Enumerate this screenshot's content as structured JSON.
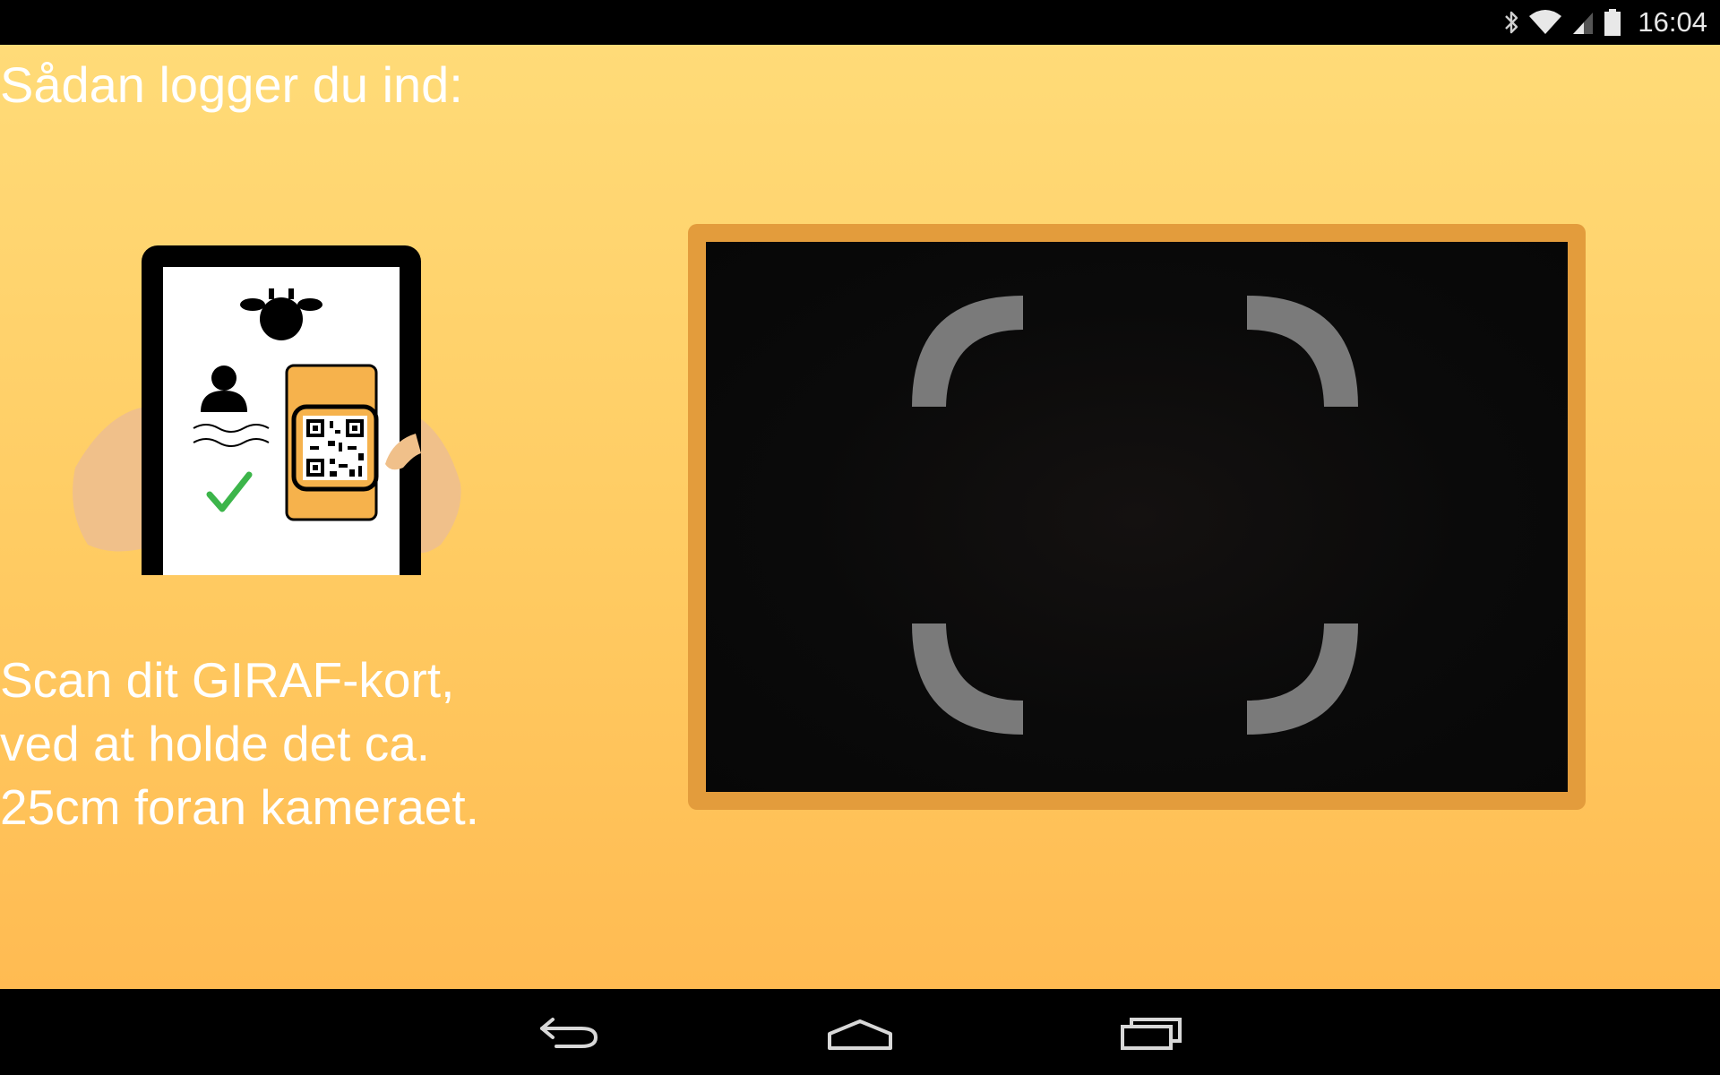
{
  "status_bar": {
    "time": "16:04",
    "icons": [
      "bluetooth-icon",
      "wifi-icon",
      "cell-signal-icon",
      "battery-icon"
    ]
  },
  "login": {
    "title": "Sådan logger du ind:",
    "instruction_lines": [
      "Scan dit GIRAF-kort,",
      "ved at holde det ca.",
      "25cm foran kameraet."
    ]
  },
  "camera": {
    "icons": [
      "scan-frame-icon"
    ]
  },
  "navigation_bar": {
    "buttons": [
      "back-button",
      "home-button",
      "recent-apps-button"
    ]
  },
  "colors": {
    "background_top": "#ffdb78",
    "background_bottom": "#ffbb52",
    "camera_border": "#e39c3c",
    "scan_brackets": "#7a7a7a",
    "checkmark": "#3cb54a"
  }
}
